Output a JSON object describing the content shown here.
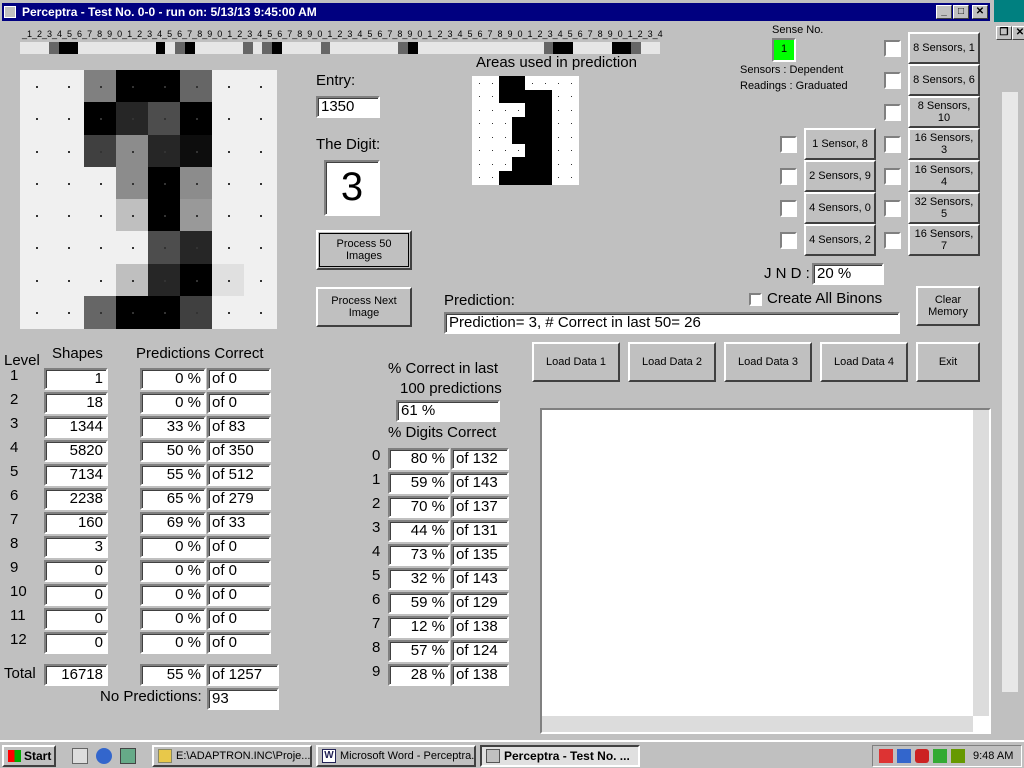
{
  "window": {
    "title": "Perceptra - Test No. 0-0 - run on: 5/13/13  9:45:00 AM",
    "minimize_glyph": "_",
    "maximize_glyph": "□",
    "close_glyph": "✕"
  },
  "ruler": {
    "text": "_1_2_3_4_5_6_7_8_9_0_1_2_3_4_5_6_7_8_9_0_1_2_3_4_5_6_7_8_9_0_1_2_3_4_5_6_7_8_9_0_1_2_3_4_5_6_7_8_9_0_1_2_3_4_5_6_7_8_9_0_1_2_3_4"
  },
  "sense": {
    "label": "Sense No.",
    "value": "1",
    "sensors_label": "Sensors  :  Dependent",
    "readings_label": "Readings : Graduated"
  },
  "entry": {
    "label": "Entry:",
    "value": "1350"
  },
  "digit": {
    "label": "The Digit:",
    "value": "3"
  },
  "areas_label": "Areas used in prediction",
  "buttons": {
    "process50": "Process 50 Images",
    "processNext": "Process Next Image",
    "clearMemory": "Clear Memory",
    "load1": "Load Data 1",
    "load2": "Load Data 2",
    "load3": "Load Data 3",
    "load4": "Load Data 4",
    "exit": "Exit"
  },
  "sensor_buttons": [
    "8 Sensors, 1",
    "8 Sensors, 6",
    "8 Sensors, 10",
    "16 Sensors, 3",
    "16 Sensors, 4",
    "32 Sensors, 5",
    "16 Sensors, 7"
  ],
  "sensor_buttons_left": [
    "1 Sensor, 8",
    "2 Sensors, 9",
    "4 Sensors, 0",
    "4 Sensors, 2"
  ],
  "jnd": {
    "label": "J N D :",
    "value": "20 %"
  },
  "prediction": {
    "label": "Prediction:",
    "value": "Prediction= 3, # Correct in last 50= 26",
    "create_all_binons": "Create All Binons"
  },
  "levels": {
    "header_level": "Level",
    "header_shapes": "Shapes",
    "header_predictions": "Predictions Correct",
    "rows": [
      {
        "level": "1",
        "shapes": "1",
        "pct": "0 %",
        "of": "of 0"
      },
      {
        "level": "2",
        "shapes": "18",
        "pct": "0 %",
        "of": "of 0"
      },
      {
        "level": "3",
        "shapes": "1344",
        "pct": "33 %",
        "of": "of 83"
      },
      {
        "level": "4",
        "shapes": "5820",
        "pct": "50 %",
        "of": "of 350"
      },
      {
        "level": "5",
        "shapes": "7134",
        "pct": "55 %",
        "of": "of 512"
      },
      {
        "level": "6",
        "shapes": "2238",
        "pct": "65 %",
        "of": "of 279"
      },
      {
        "level": "7",
        "shapes": "160",
        "pct": "69 %",
        "of": "of 33"
      },
      {
        "level": "8",
        "shapes": "3",
        "pct": "0 %",
        "of": "of 0"
      },
      {
        "level": "9",
        "shapes": "0",
        "pct": "0 %",
        "of": "of 0"
      },
      {
        "level": "10",
        "shapes": "0",
        "pct": "0 %",
        "of": "of 0"
      },
      {
        "level": "11",
        "shapes": "0",
        "pct": "0 %",
        "of": "of 0"
      },
      {
        "level": "12",
        "shapes": "0",
        "pct": "0 %",
        "of": "of 0"
      }
    ],
    "total_label": "Total",
    "total_shapes": "16718",
    "total_pct": "55 %",
    "total_of": "of 1257",
    "no_predictions_label": "No Predictions:",
    "no_predictions_value": "93"
  },
  "pct_last": {
    "label1": "% Correct in last",
    "label2": "100 predictions",
    "value": "61 %"
  },
  "digits": {
    "label": "% Digits Correct",
    "rows": [
      {
        "digit": "0",
        "pct": "80 %",
        "of": "of 132"
      },
      {
        "digit": "1",
        "pct": "59 %",
        "of": "of 143"
      },
      {
        "digit": "2",
        "pct": "70 %",
        "of": "of 137"
      },
      {
        "digit": "3",
        "pct": "44 %",
        "of": "of 131"
      },
      {
        "digit": "4",
        "pct": "73 %",
        "of": "of 135"
      },
      {
        "digit": "5",
        "pct": "32 %",
        "of": "of 143"
      },
      {
        "digit": "6",
        "pct": "59 %",
        "of": "of 129"
      },
      {
        "digit": "7",
        "pct": "12 %",
        "of": "of 138"
      },
      {
        "digit": "8",
        "pct": "57 %",
        "of": "of 124"
      },
      {
        "digit": "9",
        "pct": "28 %",
        "of": "of 138"
      }
    ]
  },
  "image_grid": {
    "rows": 8,
    "cols": 8,
    "levels": [
      [
        0.06,
        0.06,
        0.5,
        1.0,
        1.0,
        0.6,
        0.06,
        0.06
      ],
      [
        0.06,
        0.06,
        1.0,
        0.85,
        0.7,
        1.0,
        0.06,
        0.06
      ],
      [
        0.06,
        0.06,
        0.75,
        0.45,
        0.85,
        0.95,
        0.06,
        0.06
      ],
      [
        0.06,
        0.06,
        0.06,
        0.45,
        1.0,
        0.45,
        0.06,
        0.06
      ],
      [
        0.06,
        0.06,
        0.06,
        0.25,
        1.0,
        0.4,
        0.06,
        0.06
      ],
      [
        0.06,
        0.06,
        0.06,
        0.06,
        0.7,
        0.85,
        0.06,
        0.06
      ],
      [
        0.06,
        0.06,
        0.06,
        0.25,
        0.85,
        1.0,
        0.12,
        0.06
      ],
      [
        0.06,
        0.06,
        0.6,
        1.0,
        1.0,
        0.75,
        0.06,
        0.06
      ]
    ]
  },
  "areas_grid": {
    "rows": 8,
    "cols": 8,
    "cells": [
      [
        0,
        0,
        1,
        1,
        0,
        0,
        0,
        0
      ],
      [
        0,
        0,
        1,
        1,
        1,
        1,
        0,
        0
      ],
      [
        0,
        0,
        0,
        0,
        1,
        1,
        0,
        0
      ],
      [
        0,
        0,
        0,
        1,
        1,
        1,
        0,
        0
      ],
      [
        0,
        0,
        0,
        1,
        1,
        1,
        0,
        0
      ],
      [
        0,
        0,
        0,
        0,
        1,
        1,
        0,
        0
      ],
      [
        0,
        0,
        0,
        1,
        1,
        1,
        0,
        0
      ],
      [
        0,
        0,
        1,
        1,
        1,
        1,
        0,
        0
      ]
    ]
  },
  "sensor_strip": [
    0.1,
    0.1,
    0.1,
    0.6,
    1,
    1,
    0.1,
    0.1,
    0.1,
    0.1,
    0.1,
    0.1,
    0.1,
    0.1,
    1,
    0.1,
    0.6,
    1,
    0.1,
    0.1,
    0.1,
    0.1,
    0.1,
    0.6,
    0.1,
    0.6,
    1,
    0.1,
    0.1,
    0.1,
    0.1,
    0.6,
    0.1,
    0.1,
    0.1,
    0.1,
    0.1,
    0.1,
    0.1,
    0.6,
    1,
    0.1,
    0.1,
    0.1,
    0.1,
    0.1,
    0.1,
    0.1,
    0.1,
    0.1,
    0.1,
    0.1,
    0.1,
    0.1,
    0.6,
    1,
    1,
    0.1,
    0.1,
    0.1,
    0.1,
    1,
    1,
    0.6,
    0.1,
    0.1
  ],
  "taskbar": {
    "start": "Start",
    "tasks": [
      "E:\\ADAPTRON.INC\\Proje...",
      "Microsoft Word - Perceptra...",
      "Perceptra - Test No. ..."
    ],
    "time": "9:48 AM"
  },
  "colors": {
    "title_bar": "#000080",
    "face": "#c0c0c0",
    "sense_indicator": "#00ff00",
    "desktop": "#008080"
  }
}
